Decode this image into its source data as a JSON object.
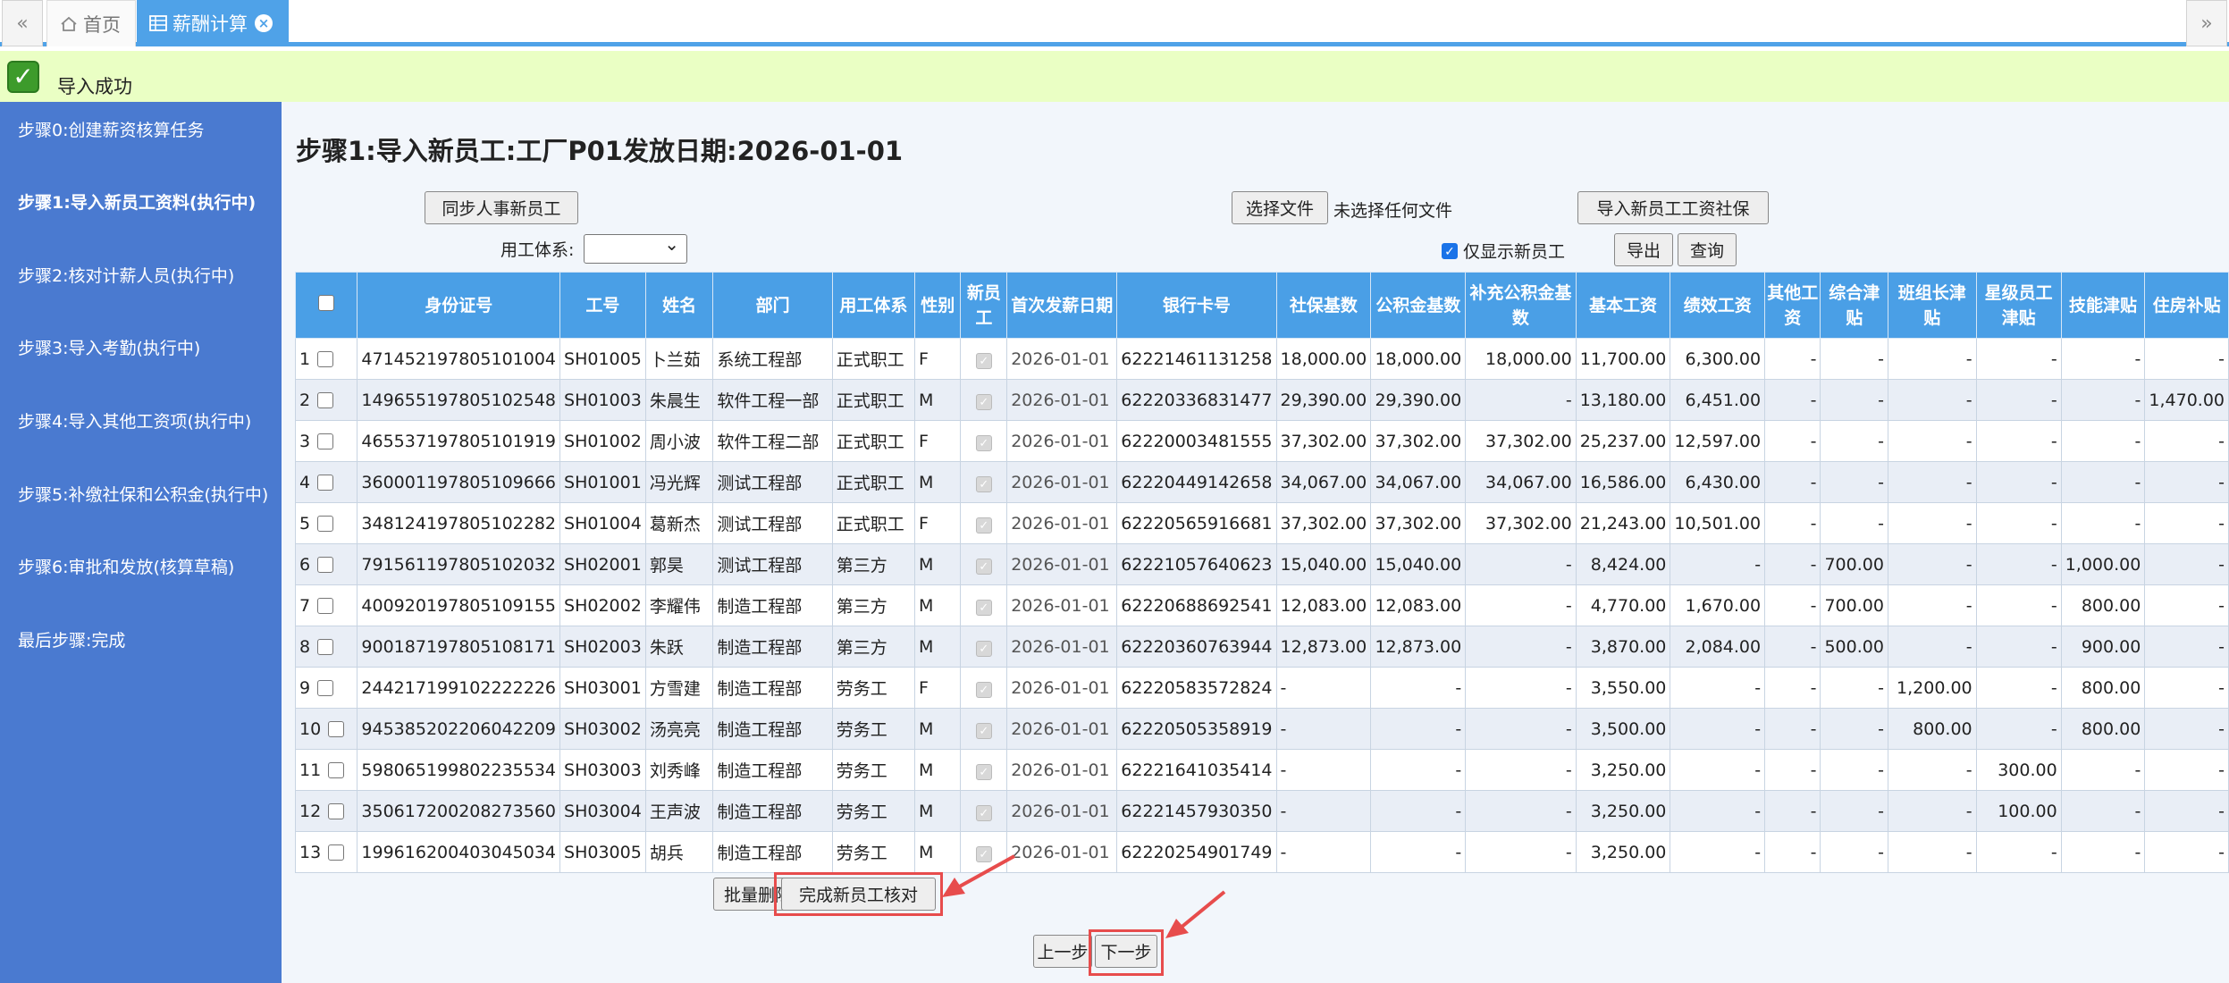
{
  "tabs": {
    "home": "首页",
    "active": "薪酬计算"
  },
  "banner": {
    "text": "导入成功"
  },
  "sidebar": {
    "steps": [
      "步骤0:创建薪资核算任务",
      "步骤1:导入新员工资料(执行中)",
      "步骤2:核对计薪人员(执行中)",
      "步骤3:导入考勤(执行中)",
      "步骤4:导入其他工资项(执行中)",
      "步骤5:补缴社保和公积金(执行中)",
      "步骤6:审批和发放(核算草稿)",
      "最后步骤:完成"
    ]
  },
  "main": {
    "title": "步骤1:导入新员工:工厂P01发放日期:2026-01-01",
    "sync_button": "同步人事新员工",
    "choose_file_button": "选择文件",
    "no_file_text": "未选择任何文件",
    "import_button": "导入新员工工资社保",
    "employment_type_label": "用工体系:",
    "only_new_label": "仅显示新员工",
    "export_button": "导出",
    "query_button": "查询",
    "batch_delete_button": "批量删除",
    "complete_button": "完成新员工核对",
    "prev_button": "上一步",
    "next_button": "下一步"
  },
  "table": {
    "headers": [
      "身份证号",
      "工号",
      "姓名",
      "部门",
      "用工体系",
      "性别",
      "新员工",
      "首次发薪日期",
      "银行卡号",
      "社保基数",
      "公积金基数",
      "补充公积金基数",
      "基本工资",
      "绩效工资",
      "其他工资",
      "综合津贴",
      "班组长津贴",
      "星级员工津贴",
      "技能津贴",
      "住房补贴"
    ],
    "rows": [
      [
        "1",
        "471452197805101004",
        "SH01005",
        "卜兰茹",
        "系统工程部",
        "正式职工",
        "F",
        "2026-01-01",
        "62221461131258",
        "18,000.00",
        "18,000.00",
        "18,000.00",
        "11,700.00",
        "6,300.00",
        "-",
        "-",
        "-",
        "-",
        "-",
        "-"
      ],
      [
        "2",
        "149655197805102548",
        "SH01003",
        "朱晨生",
        "软件工程一部",
        "正式职工",
        "M",
        "2026-01-01",
        "62220336831477",
        "29,390.00",
        "29,390.00",
        "-",
        "13,180.00",
        "6,451.00",
        "-",
        "-",
        "-",
        "-",
        "-",
        "1,470.00"
      ],
      [
        "3",
        "465537197805101919",
        "SH01002",
        "周小波",
        "软件工程二部",
        "正式职工",
        "F",
        "2026-01-01",
        "62220003481555",
        "37,302.00",
        "37,302.00",
        "37,302.00",
        "25,237.00",
        "12,597.00",
        "-",
        "-",
        "-",
        "-",
        "-",
        "-"
      ],
      [
        "4",
        "360001197805109666",
        "SH01001",
        "冯光辉",
        "测试工程部",
        "正式职工",
        "M",
        "2026-01-01",
        "62220449142658",
        "34,067.00",
        "34,067.00",
        "34,067.00",
        "16,586.00",
        "6,430.00",
        "-",
        "-",
        "-",
        "-",
        "-",
        "-"
      ],
      [
        "5",
        "348124197805102282",
        "SH01004",
        "葛新杰",
        "测试工程部",
        "正式职工",
        "F",
        "2026-01-01",
        "62220565916681",
        "37,302.00",
        "37,302.00",
        "37,302.00",
        "21,243.00",
        "10,501.00",
        "-",
        "-",
        "-",
        "-",
        "-",
        "-"
      ],
      [
        "6",
        "791561197805102032",
        "SH02001",
        "郭昊",
        "测试工程部",
        "第三方",
        "M",
        "2026-01-01",
        "62221057640623",
        "15,040.00",
        "15,040.00",
        "-",
        "8,424.00",
        "-",
        "-",
        "700.00",
        "-",
        "-",
        "1,000.00",
        "-"
      ],
      [
        "7",
        "400920197805109155",
        "SH02002",
        "李耀伟",
        "制造工程部",
        "第三方",
        "M",
        "2026-01-01",
        "62220688692541",
        "12,083.00",
        "12,083.00",
        "-",
        "4,770.00",
        "1,670.00",
        "-",
        "700.00",
        "-",
        "-",
        "800.00",
        "-"
      ],
      [
        "8",
        "900187197805108171",
        "SH02003",
        "朱跃",
        "制造工程部",
        "第三方",
        "M",
        "2026-01-01",
        "62220360763944",
        "12,873.00",
        "12,873.00",
        "-",
        "3,870.00",
        "2,084.00",
        "-",
        "500.00",
        "-",
        "-",
        "900.00",
        "-"
      ],
      [
        "9",
        "244217199102222226",
        "SH03001",
        "方雪建",
        "制造工程部",
        "劳务工",
        "F",
        "2026-01-01",
        "62220583572824",
        "-",
        "-",
        "-",
        "3,550.00",
        "-",
        "-",
        "-",
        "1,200.00",
        "-",
        "800.00",
        "-"
      ],
      [
        "10",
        "945385202206042209",
        "SH03002",
        "汤亮亮",
        "制造工程部",
        "劳务工",
        "M",
        "2026-01-01",
        "62220505358919",
        "-",
        "-",
        "-",
        "3,500.00",
        "-",
        "-",
        "-",
        "800.00",
        "-",
        "800.00",
        "-"
      ],
      [
        "11",
        "598065199802235534",
        "SH03003",
        "刘秀峰",
        "制造工程部",
        "劳务工",
        "M",
        "2026-01-01",
        "62221641035414",
        "-",
        "-",
        "-",
        "3,250.00",
        "-",
        "-",
        "-",
        "-",
        "300.00",
        "-",
        "-"
      ],
      [
        "12",
        "350617200208273560",
        "SH03004",
        "王声波",
        "制造工程部",
        "劳务工",
        "M",
        "2026-01-01",
        "62221457930350",
        "-",
        "-",
        "-",
        "3,250.00",
        "-",
        "-",
        "-",
        "-",
        "100.00",
        "-",
        "-"
      ],
      [
        "13",
        "199616200403045034",
        "SH03005",
        "胡兵",
        "制造工程部",
        "劳务工",
        "M",
        "2026-01-01",
        "62220254901749",
        "-",
        "-",
        "-",
        "3,250.00",
        "-",
        "-",
        "-",
        "-",
        "-",
        "-",
        "-"
      ]
    ]
  },
  "colors": {
    "accent": "#4a9fe6",
    "sidebar": "#4a7ad0",
    "banner": "#eaffc4",
    "highlight": "#e74c4c"
  }
}
